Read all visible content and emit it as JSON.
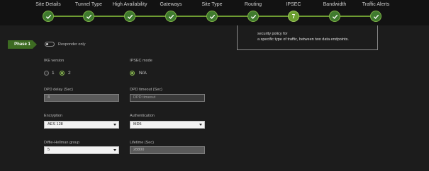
{
  "stepper": {
    "steps": [
      {
        "label": "Site Details",
        "state": "done"
      },
      {
        "label": "Tunnel Type",
        "state": "done"
      },
      {
        "label": "High Availability",
        "state": "done"
      },
      {
        "label": "Gateways",
        "state": "done"
      },
      {
        "label": "Site Type",
        "state": "done"
      },
      {
        "label": "Routing",
        "state": "done"
      },
      {
        "label": "IPSEC",
        "state": "current",
        "number": "7"
      },
      {
        "label": "Bandwidth",
        "state": "done"
      },
      {
        "label": "Traffic Alerts",
        "state": "done"
      }
    ],
    "accent_color": "#6b9e2f",
    "done_icon": "checkmark-icon"
  },
  "info": {
    "line1": "security policy for",
    "line2": "a specific type of traffic, between two data endpoints."
  },
  "phase": {
    "label": "Phase 1",
    "responder_label": "Responder only",
    "responder_on": false
  },
  "form": {
    "ike_version": {
      "label": "IKE version",
      "options": [
        "1",
        "2"
      ],
      "selected": "2"
    },
    "ipsec_mode": {
      "label": "IPSEC mode",
      "option": "N/A",
      "selected": true
    },
    "dpd_delay": {
      "label": "DPD delay (Sec)",
      "value": "4"
    },
    "dpd_timeout": {
      "label": "DPD timeout (Sec)",
      "placeholder": "DPD timeout"
    },
    "encryption": {
      "label": "Encryption",
      "value": "AES 128"
    },
    "authentication": {
      "label": "Authentication",
      "value": "MD5"
    },
    "dh_group": {
      "label": "Diffie-Hellman group",
      "value": "5"
    },
    "lifetime": {
      "label": "Lifetime (Sec)",
      "value": "28800"
    }
  }
}
